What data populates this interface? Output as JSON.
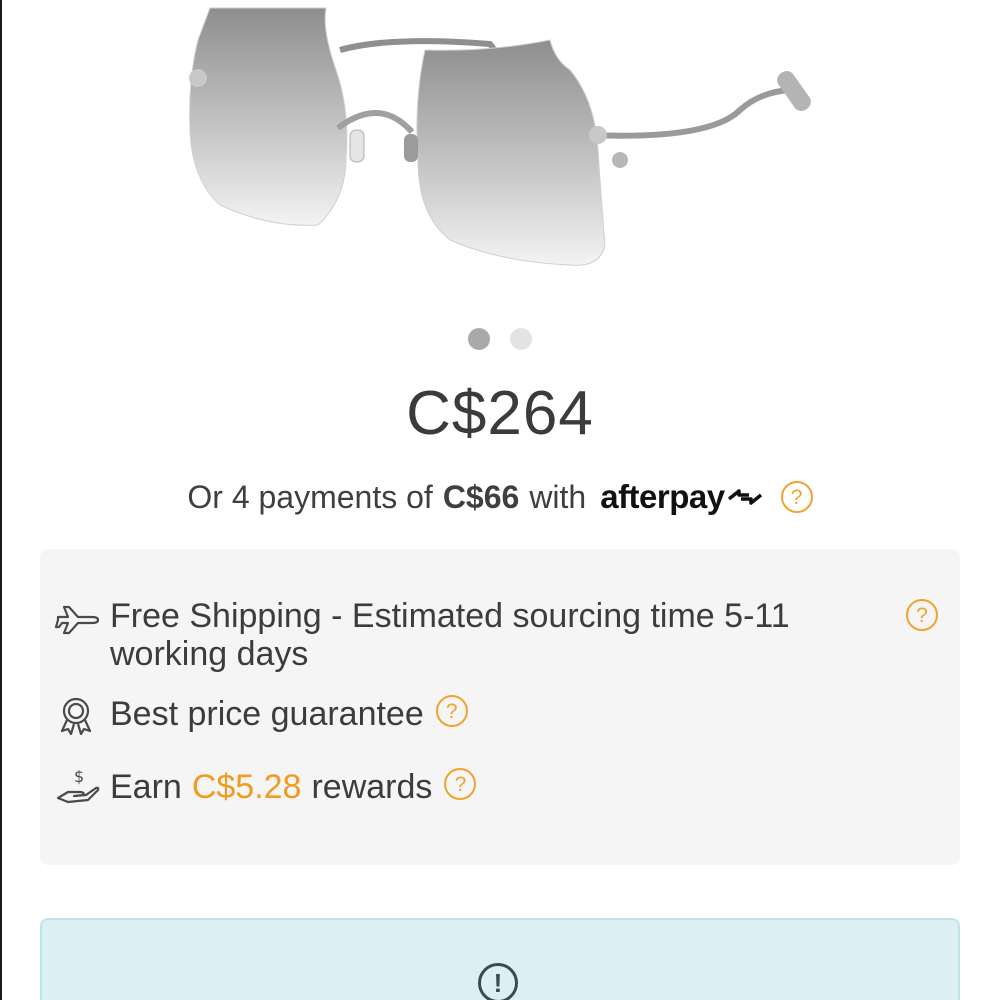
{
  "product": {
    "image_alt": "rimless gradient grey sunglasses",
    "carousel": {
      "total_slides": 2,
      "active_slide": 1
    }
  },
  "price": {
    "display": "C$264"
  },
  "afterpay": {
    "prefix": "Or 4 payments of",
    "amount": "C$66",
    "with": "with",
    "brand": "afterpay"
  },
  "info": {
    "shipping": "Free Shipping - Estimated sourcing time 5-11 working days",
    "best_price": "Best price guarantee",
    "earn_prefix": "Earn",
    "earn_amount": "C$5.28",
    "earn_suffix": "rewards"
  },
  "notice": {
    "icon": "exclamation-circle-icon"
  },
  "colors": {
    "accent": "#f2a22f",
    "info_bg": "#f5f5f5",
    "notice_bg": "#dcf0f4"
  }
}
